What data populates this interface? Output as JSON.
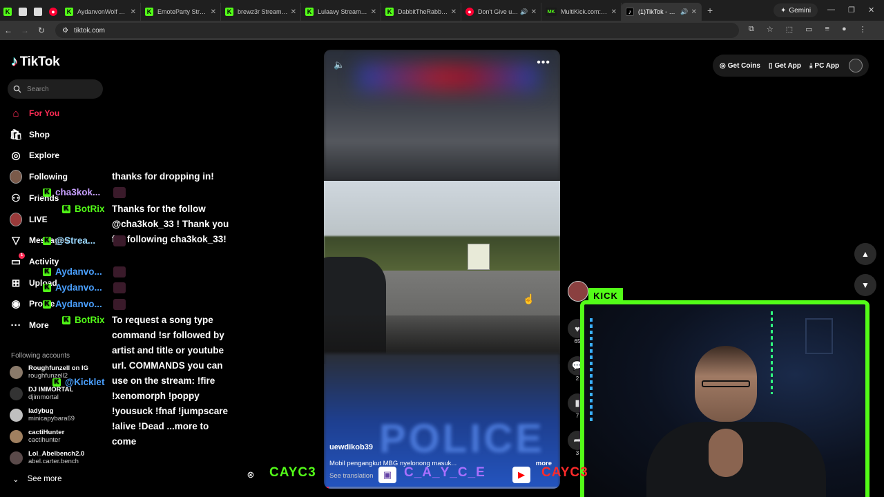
{
  "browser": {
    "tabs": [
      {
        "title": "",
        "type": "pinned",
        "fav": "K"
      },
      {
        "title": "",
        "type": "pinned",
        "fav": "plain"
      },
      {
        "title": "",
        "type": "pinned",
        "fav": "plain"
      },
      {
        "title": "",
        "type": "pinned",
        "fav": "yt"
      },
      {
        "title": "AydanvonWolf Stre",
        "fav": "K"
      },
      {
        "title": "EmoteParty Stream",
        "fav": "K"
      },
      {
        "title": "brewz3r Stream - W",
        "fav": "K"
      },
      {
        "title": "Lulaavy Stream - W",
        "fav": "K"
      },
      {
        "title": "DabbitTheRabbit St",
        "fav": "K"
      },
      {
        "title": "Don't Give up t",
        "fav": "yt",
        "speaker": true
      },
      {
        "title": "MultiKick.com: Wat",
        "fav": "MK"
      },
      {
        "title": "(1)TikTok - Mak",
        "fav": "tt",
        "speaker": true,
        "active": true
      }
    ],
    "new_tab": "+",
    "gemini_label": "Gemini",
    "url": "tiktok.com"
  },
  "tiktok": {
    "logo": "TikTok",
    "search_placeholder": "Search",
    "nav": [
      {
        "label": "For You",
        "icon": "home-icon",
        "active": true
      },
      {
        "label": "Shop",
        "icon": "shop-icon"
      },
      {
        "label": "Explore",
        "icon": "compass-icon"
      },
      {
        "label": "Following",
        "icon": "avatar-icon"
      },
      {
        "label": "Friends",
        "icon": "friends-icon"
      },
      {
        "label": "LIVE",
        "icon": "live-icon"
      },
      {
        "label": "Messages",
        "icon": "message-icon"
      },
      {
        "label": "Activity",
        "icon": "activity-icon",
        "badge": "1"
      },
      {
        "label": "Upload",
        "icon": "upload-icon"
      },
      {
        "label": "Profile",
        "icon": "profile-icon"
      },
      {
        "label": "More",
        "icon": "more-icon"
      }
    ],
    "following_title": "Following accounts",
    "following": [
      {
        "name": "Roughfunzell on IG",
        "handle": "roughfunzell2"
      },
      {
        "name": "DJ IMMORTAL",
        "handle": "djimmortal"
      },
      {
        "name": "ladybug",
        "handle": "minicapybara69"
      },
      {
        "name": "cactiHunter",
        "handle": "cactihunter"
      },
      {
        "name": "Lol_Abelbench2.0",
        "handle": "abel.carter.bench"
      }
    ],
    "see_more": "See more",
    "topbar": {
      "coins": "Get Coins",
      "app": "Get App",
      "pc": "PC App"
    },
    "video": {
      "author": "uewdikob39",
      "caption": "Mobil pengangkut MBG nyelonong masuk...",
      "more": "more",
      "see_translation": "See translation",
      "bg_text": "POLICE",
      "progress": 0.02
    },
    "actions": [
      "65",
      "2",
      "7",
      "3"
    ]
  },
  "chat": [
    {
      "user": "",
      "msg": "thanks for dropping in!"
    },
    {
      "user": "cha3kok...",
      "color": "#c8a0ff"
    },
    {
      "user": "BotRix",
      "color": "#53fc18",
      "msg": "Thanks for the follow @cha3kok_33 ! Thank you for following cha3kok_33!"
    },
    {
      "user": "@Strea...",
      "color": "#9ad8ff"
    },
    {
      "user": "Aydanvo...",
      "color": "#4aa0ff"
    },
    {
      "user": "Aydanvo...",
      "color": "#4aa0ff"
    },
    {
      "user": "Aydanvo...",
      "color": "#4aa0ff"
    },
    {
      "user": "BotRix",
      "color": "#53fc18",
      "msg": "To request a song type command !sr followed by artist and title or youtube url. COMMANDS you can use on the stream: !fire !xenomorph !poppy !yousuck !fnaf !jumpscare !alive !Dead ...more to come"
    },
    {
      "user": "@Kicklet",
      "color": "#4aa0ff"
    }
  ],
  "overlay": {
    "kick_tag": "KICK",
    "handle_green": "CAYC3",
    "handle_purple": "C_A_Y_C_E",
    "handle_red": "CAYC3"
  }
}
